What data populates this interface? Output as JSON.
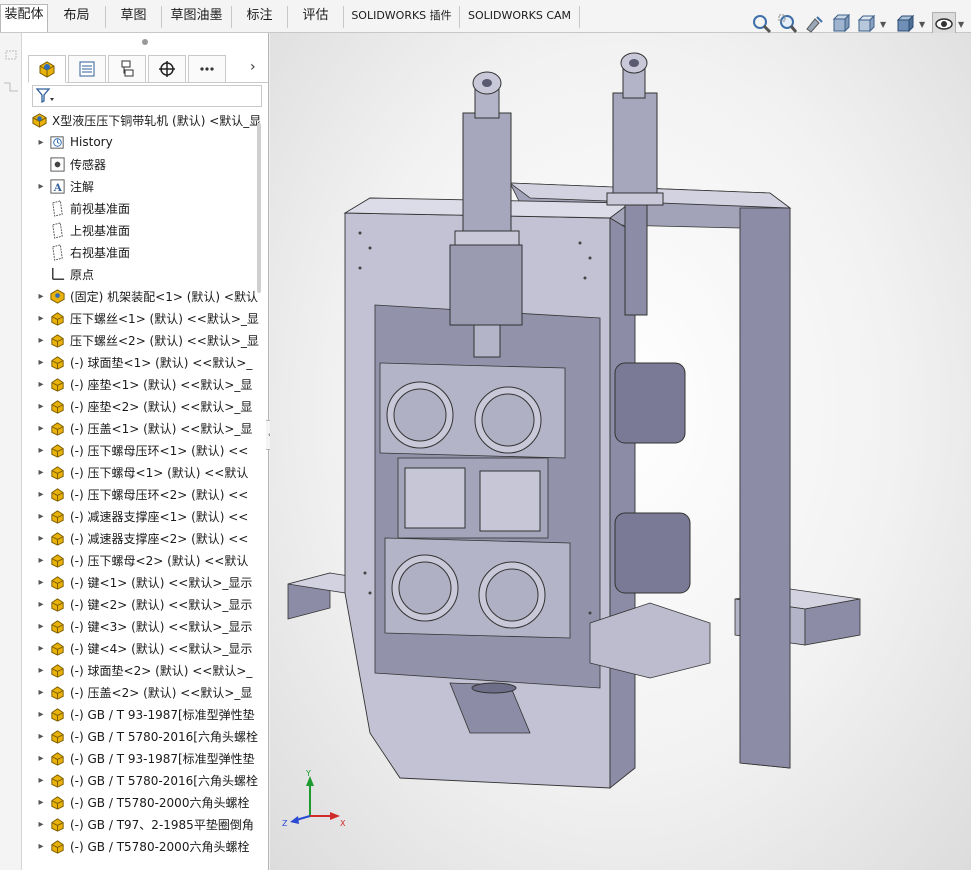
{
  "tabs": [
    {
      "label": "装配体",
      "active": true
    },
    {
      "label": "布局",
      "active": false
    },
    {
      "label": "草图",
      "active": false
    },
    {
      "label": "草图油墨",
      "active": false
    },
    {
      "label": "标注",
      "active": false
    },
    {
      "label": "评估",
      "active": false
    },
    {
      "label": "SOLIDWORKS 插件",
      "active": false
    },
    {
      "label": "SOLIDWORKS CAM",
      "active": false
    }
  ],
  "view_toolbar": {
    "icons": [
      "zoom-to-fit-icon",
      "zoom-area-icon",
      "previous-view-icon",
      "section-view-icon",
      "view-orientation-icon",
      "display-style-icon",
      "hide-show-items-icon"
    ]
  },
  "feature_manager": {
    "tab_icons": [
      "feature-manager-icon",
      "property-manager-icon",
      "configuration-manager-icon",
      "dimxpert-icon",
      "more-tabs-icon"
    ],
    "root": "X型液压压下铜带轧机 (默认) <默认_显",
    "items": [
      {
        "label": "History",
        "icon": "history-icon",
        "expandable": true
      },
      {
        "label": "传感器",
        "icon": "sensor-icon",
        "expandable": false
      },
      {
        "label": "注解",
        "icon": "annotation-icon",
        "expandable": true
      },
      {
        "label": "前视基准面",
        "icon": "plane-icon",
        "expandable": false
      },
      {
        "label": "上视基准面",
        "icon": "plane-icon",
        "expandable": false
      },
      {
        "label": "右视基准面",
        "icon": "plane-icon",
        "expandable": false
      },
      {
        "label": "原点",
        "icon": "origin-icon",
        "expandable": false
      },
      {
        "label": "(固定) 机架装配<1> (默认) <默认",
        "icon": "subassembly-icon",
        "expandable": true
      },
      {
        "label": "压下螺丝<1> (默认) <<默认>_显",
        "icon": "part-icon",
        "expandable": true
      },
      {
        "label": "压下螺丝<2> (默认) <<默认>_显",
        "icon": "part-icon",
        "expandable": true
      },
      {
        "label": "(-) 球面垫<1> (默认) <<默认>_",
        "icon": "part-icon",
        "expandable": true
      },
      {
        "label": "(-) 座垫<1> (默认) <<默认>_显",
        "icon": "part-icon",
        "expandable": true
      },
      {
        "label": "(-) 座垫<2> (默认) <<默认>_显",
        "icon": "part-icon",
        "expandable": true
      },
      {
        "label": "(-) 压盖<1> (默认) <<默认>_显",
        "icon": "part-icon",
        "expandable": true
      },
      {
        "label": "(-) 压下螺母压环<1> (默认) <<",
        "icon": "part-icon",
        "expandable": true
      },
      {
        "label": "(-) 压下螺母<1> (默认) <<默认",
        "icon": "part-icon",
        "expandable": true
      },
      {
        "label": "(-) 压下螺母压环<2> (默认) <<",
        "icon": "part-icon",
        "expandable": true
      },
      {
        "label": "(-) 减速器支撑座<1> (默认) <<",
        "icon": "part-icon",
        "expandable": true
      },
      {
        "label": "(-) 减速器支撑座<2> (默认) <<",
        "icon": "part-icon",
        "expandable": true
      },
      {
        "label": "(-) 压下螺母<2> (默认) <<默认",
        "icon": "part-icon",
        "expandable": true
      },
      {
        "label": "(-) 键<1> (默认) <<默认>_显示",
        "icon": "part-icon",
        "expandable": true
      },
      {
        "label": "(-) 键<2> (默认) <<默认>_显示",
        "icon": "part-icon",
        "expandable": true
      },
      {
        "label": "(-) 键<3> (默认) <<默认>_显示",
        "icon": "part-icon",
        "expandable": true
      },
      {
        "label": "(-) 键<4> (默认) <<默认>_显示",
        "icon": "part-icon",
        "expandable": true
      },
      {
        "label": "(-) 球面垫<2> (默认) <<默认>_",
        "icon": "part-icon",
        "expandable": true
      },
      {
        "label": "(-) 压盖<2> (默认) <<默认>_显",
        "icon": "part-icon",
        "expandable": true
      },
      {
        "label": "(-) GB / T 93-1987[标准型弹性垫",
        "icon": "part-icon",
        "expandable": true
      },
      {
        "label": "(-) GB / T 5780-2016[六角头螺栓",
        "icon": "part-icon",
        "expandable": true
      },
      {
        "label": "(-) GB / T 93-1987[标准型弹性垫",
        "icon": "part-icon",
        "expandable": true
      },
      {
        "label": "(-) GB / T 5780-2016[六角头螺栓",
        "icon": "part-icon",
        "expandable": true
      },
      {
        "label": "(-) GB / T5780-2000六角头螺栓",
        "icon": "part-icon",
        "expandable": true
      },
      {
        "label": "(-) GB / T97、2-1985平垫圈倒角",
        "icon": "part-icon",
        "expandable": true
      },
      {
        "label": "(-) GB / T5780-2000六角头螺栓",
        "icon": "part-icon",
        "expandable": true
      }
    ]
  },
  "triad": {
    "x_label": "X",
    "y_label": "Y",
    "z_label": "Z"
  },
  "colors": {
    "model": "#b4b4c8",
    "model_dark": "#8c8ca6",
    "model_light": "#d2d2e0",
    "part_icon": "#e8b20a"
  }
}
